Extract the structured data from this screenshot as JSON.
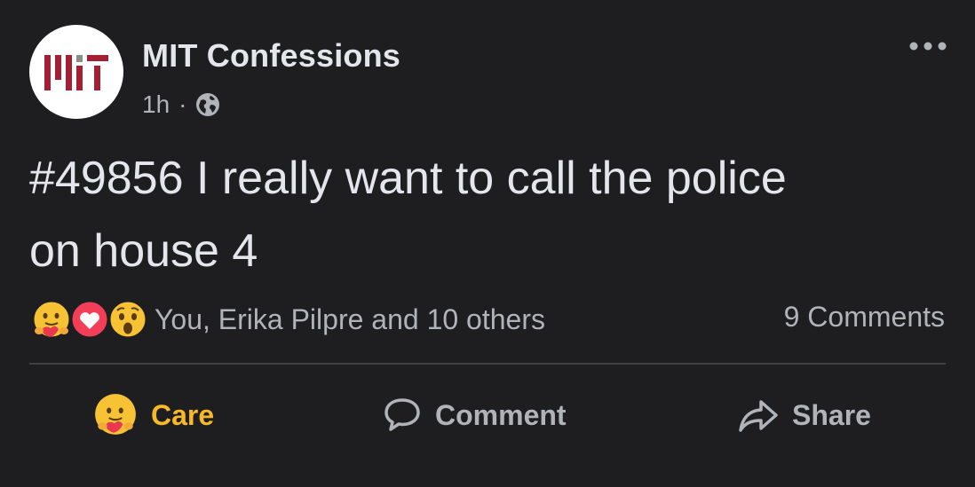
{
  "post": {
    "page_name": "MIT Confessions",
    "time": "1h",
    "separator": "·",
    "audience_icon": "globe-icon",
    "more_icon": "more-options-icon",
    "avatar_logo": "MIT",
    "text_line1": "#49856 I really want to call the police",
    "text_line2": "on house 4"
  },
  "reactions": {
    "icons": [
      "care-emoji-icon",
      "love-heart-icon",
      "wow-emoji-icon"
    ],
    "summary": "You, Erika Pilpre and 10 others",
    "comments": "9 Comments"
  },
  "actions": {
    "care_label": "Care",
    "comment_label": "Comment",
    "share_label": "Share"
  },
  "colors": {
    "background": "#1e1e21",
    "text": "#e4e6eb",
    "secondary": "#b0b3b8",
    "care_active": "#f7b928",
    "mit_red": "#a31f34",
    "mit_gray": "#8a8b8c"
  }
}
